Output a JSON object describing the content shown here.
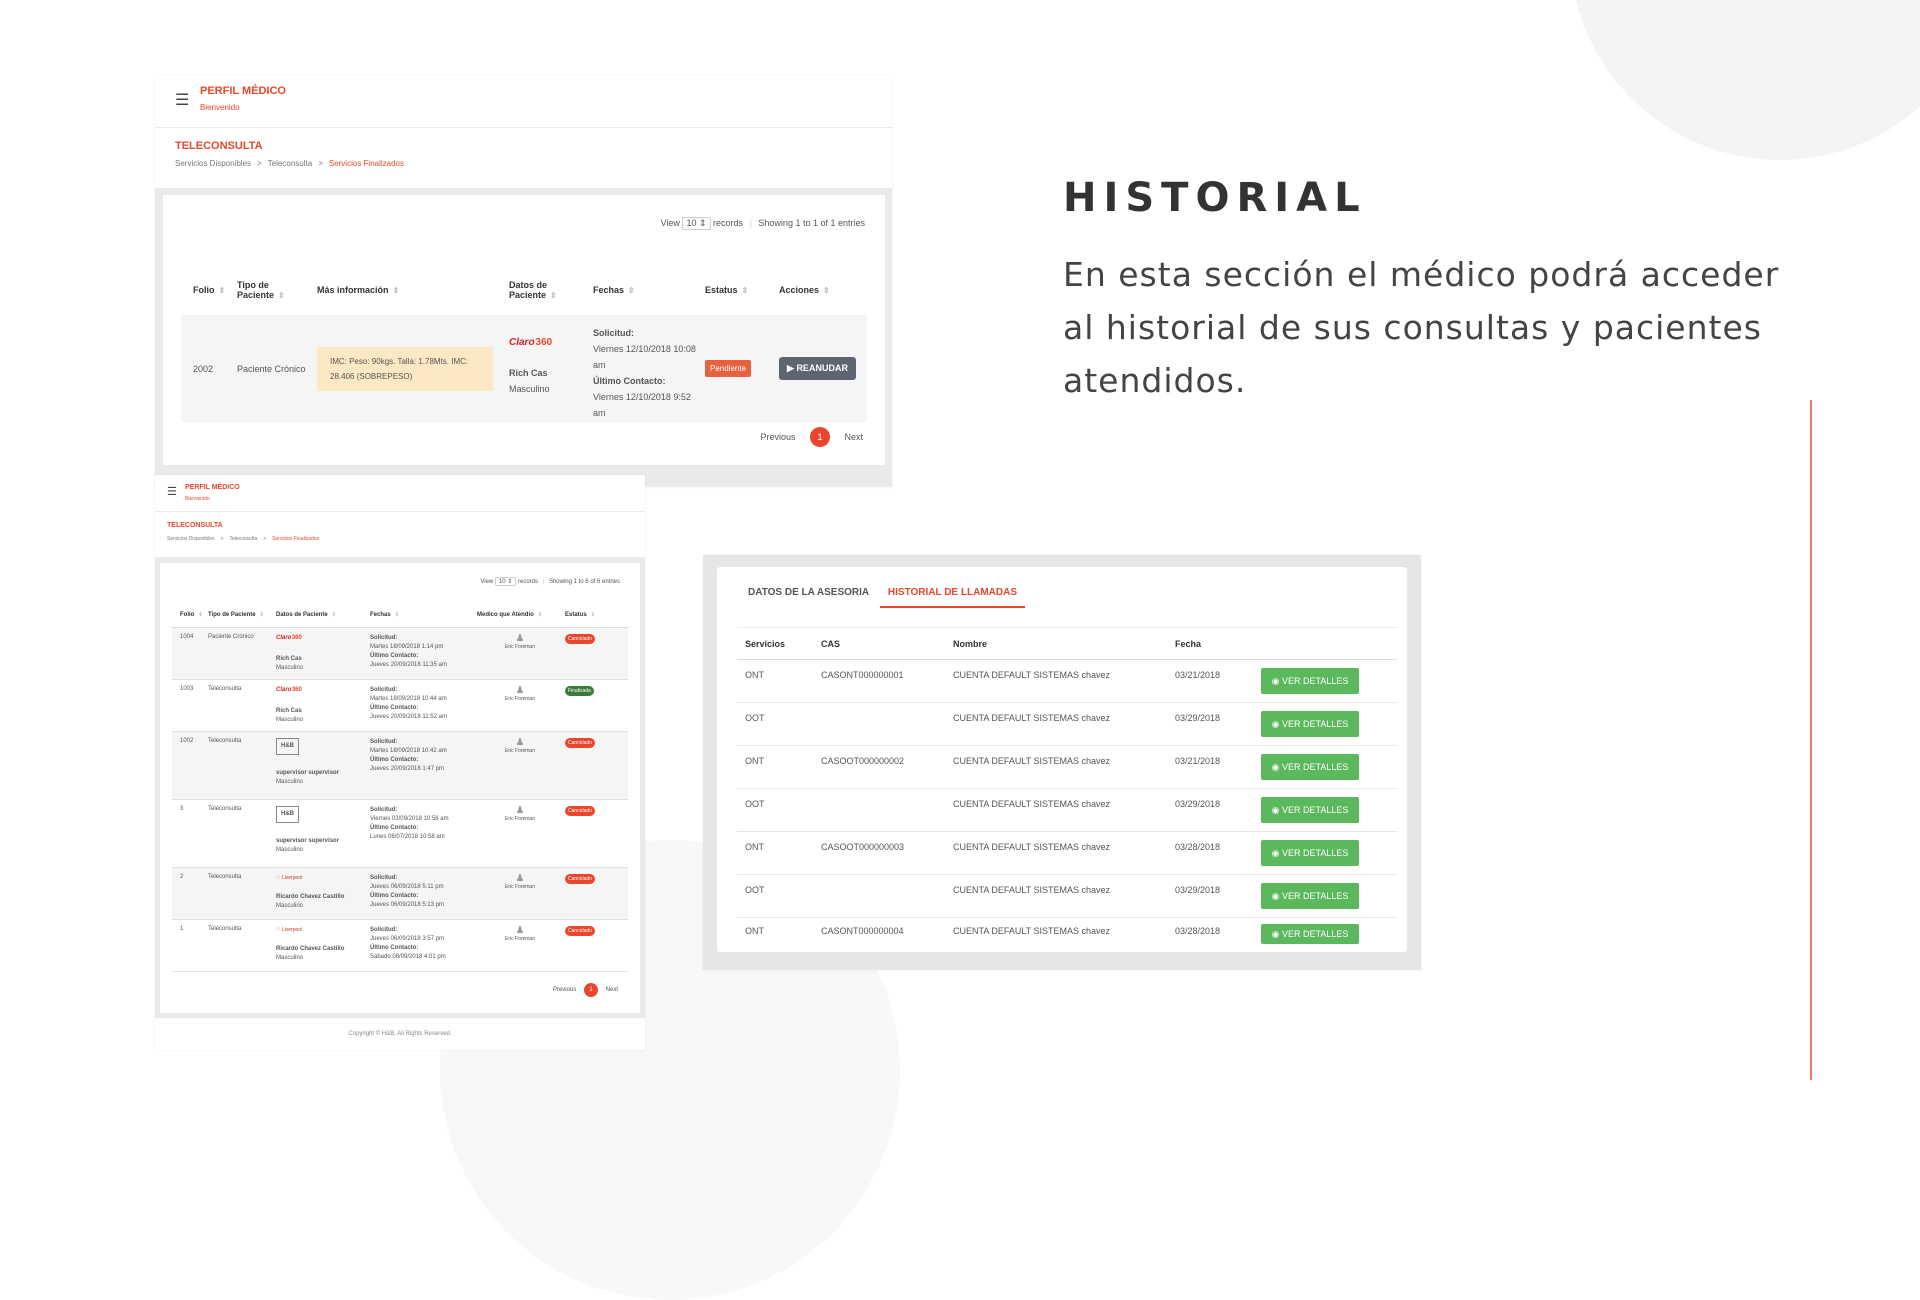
{
  "heading": "HISTORIAL",
  "description": "En esta sección el médico podrá acceder al historial de sus consultas y pacientes atendidos.",
  "shot1": {
    "brand": "PERFIL MÉDICO",
    "welcome": "Bienvenido",
    "section": "TELECONSULTA",
    "breadcrumb": [
      "Servicios Disponibles",
      "Teleconsulta",
      "Servicios Finalizados"
    ],
    "view_label": "View",
    "view_value": "10",
    "records_label": "records",
    "showing": "Showing 1 to 1 of 1 entries",
    "columns": [
      "Folio",
      "Tipo de Paciente",
      "Más información",
      "Datos de Paciente",
      "Fechas",
      "Estatus",
      "Acciones"
    ],
    "row": {
      "folio": "2002",
      "tipo": "Paciente Crónico",
      "info": "IMC: Peso: 90kgs. Talla: 1.78Mts. IMC: 28.406 (SOBREPESO)",
      "logo": "Claro 360",
      "name": "Rich Cas",
      "gender": "Masculino",
      "solicitud_label": "Solicitud:",
      "solicitud": "Viernes 12/10/2018 10:08 am",
      "ultimo_label": "Último Contacto:",
      "ultimo": "Viernes 12/10/2018 9:52 am",
      "status": "Pendiente",
      "action": "REANUDAR"
    },
    "pager": {
      "prev": "Previous",
      "page": "1",
      "next": "Next"
    }
  },
  "shot2": {
    "brand": "PERFIL MÉDICO",
    "welcome": "Bienvenido",
    "section": "TELECONSULTA",
    "breadcrumb": [
      "Servicios Disponibles",
      "Teleconsulta",
      "Servicios Finalizados"
    ],
    "view_label": "View",
    "view_value": "10",
    "records_label": "records",
    "showing": "Showing 1 to 6 of 6 entries",
    "columns": [
      "Folio",
      "Tipo de Paciente",
      "Datos de Paciente",
      "Fechas",
      "Medico que Atendio",
      "Estatus"
    ],
    "rows": [
      {
        "folio": "1004",
        "tipo": "Paciente Crónico",
        "logo": "Claro 360",
        "name": "Rich Cas",
        "gender": "Masculino",
        "solicitud": "Martes 18/09/2018 1:14 pm",
        "ultimo": "Jueves 20/09/2018 11:35 am",
        "medico": "Eric Foreman",
        "status": "Cancelado"
      },
      {
        "folio": "1003",
        "tipo": "Teleconsulta",
        "logo": "Claro 360",
        "name": "Rich Cas",
        "gender": "Masculino",
        "solicitud": "Martes 18/09/2018 10:44 am",
        "ultimo": "Jueves 20/09/2018 11:52 am",
        "medico": "Eric Foreman",
        "status": "Finalizada"
      },
      {
        "folio": "1002",
        "tipo": "Teleconsulta",
        "logo": "H&B",
        "name": "supervisor supervisor",
        "gender": "Masculino",
        "solicitud": "Martes 18/09/2018 10:42 am",
        "ultimo": "Jueves 20/09/2018 1:47 pm",
        "medico": "Eric Foreman",
        "status": "Cancelado"
      },
      {
        "folio": "3",
        "tipo": "Teleconsulta",
        "logo": "H&B",
        "name": "supervisor supervisor",
        "gender": "Masculino",
        "solicitud": "Viernes 03/09/2018 10:58 am",
        "ultimo": "Lunes 06/07/2018 10:58 am",
        "medico": "Eric Foreman",
        "status": "Cancelado"
      },
      {
        "folio": "2",
        "tipo": "Teleconsulta",
        "logo": "Liverpool",
        "name": "Ricardo Chavez Castillo",
        "gender": "Masculino",
        "solicitud": "Jueves 06/09/2018 5:11 pm",
        "ultimo": "Jueves 06/09/2018 5:13 pm",
        "medico": "Eric Foreman",
        "status": "Cancelado"
      },
      {
        "folio": "1",
        "tipo": "Teleconsulta",
        "logo": "Liverpool",
        "name": "Ricardo Chavez Castillo",
        "gender": "Masculino",
        "solicitud": "Jueves 06/09/2018 3:57 pm",
        "ultimo": "Sábado 08/09/2018 4:01 pm",
        "medico": "Eric Foreman",
        "status": "Cancelado"
      }
    ],
    "solicitud_label": "Solicitud:",
    "ultimo_label": "Último Contacto:",
    "pager": {
      "prev": "Previous",
      "page": "1",
      "next": "Next"
    },
    "copyright": "Copyright © H&B, All Rights Reserved."
  },
  "shot3": {
    "tabs": [
      "DATOS DE LA ASESORIA",
      "HISTORIAL DE LLAMADAS"
    ],
    "columns": [
      "Servicios",
      "CAS",
      "Nombre",
      "Fecha"
    ],
    "button_label": "VER DETALLES",
    "rows": [
      {
        "servicio": "ONT",
        "cas": "CASONT000000001",
        "nombre": "CUENTA DEFAULT SISTEMAS chavez",
        "fecha": "03/21/2018"
      },
      {
        "servicio": "OOT",
        "cas": "",
        "nombre": "CUENTA DEFAULT SISTEMAS chavez",
        "fecha": "03/29/2018"
      },
      {
        "servicio": "ONT",
        "cas": "CASOOT000000002",
        "nombre": "CUENTA DEFAULT SISTEMAS chavez",
        "fecha": "03/21/2018"
      },
      {
        "servicio": "OOT",
        "cas": "",
        "nombre": "CUENTA DEFAULT SISTEMAS chavez",
        "fecha": "03/29/2018"
      },
      {
        "servicio": "ONT",
        "cas": "CASOOT000000003",
        "nombre": "CUENTA DEFAULT SISTEMAS chavez",
        "fecha": "03/28/2018"
      },
      {
        "servicio": "OOT",
        "cas": "",
        "nombre": "CUENTA DEFAULT SISTEMAS chavez",
        "fecha": "03/29/2018"
      },
      {
        "servicio": "ONT",
        "cas": "CASONT000000004",
        "nombre": "CUENTA DEFAULT SISTEMAS chavez",
        "fecha": "03/28/2018"
      }
    ]
  },
  "colors": {
    "accent": "#e8472c",
    "success": "#5cb85c",
    "action": "#5d6670",
    "highlight": "#fde8c4"
  }
}
